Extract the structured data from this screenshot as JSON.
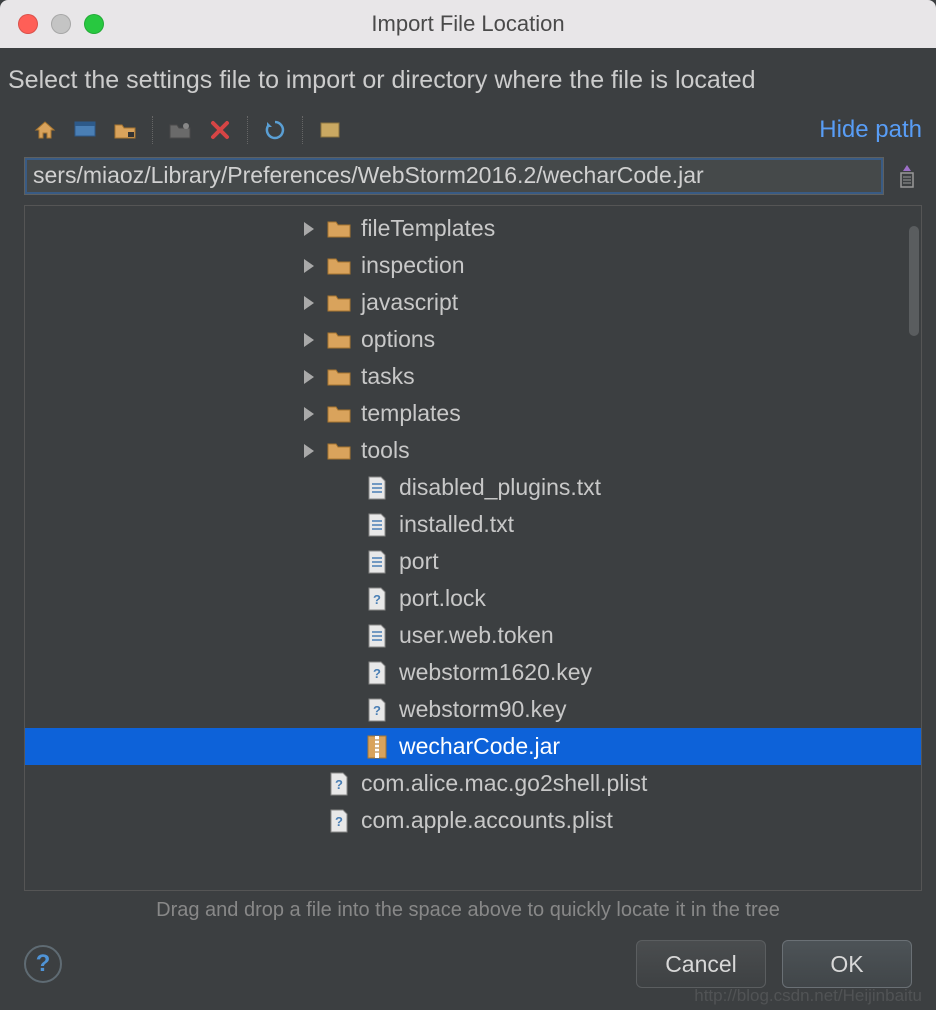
{
  "window": {
    "title": "Import File Location"
  },
  "instruction": "Select the settings file to import or directory where the file is located",
  "toolbar": {
    "hide_path": "Hide path"
  },
  "path_input": "sers/miaoz/Library/Preferences/WebStorm2016.2/wecharCode.jar",
  "tree": [
    {
      "indent": 270,
      "type": "folder",
      "arrow": true,
      "label": "fileTemplates",
      "selected": false
    },
    {
      "indent": 270,
      "type": "folder",
      "arrow": true,
      "label": "inspection",
      "selected": false
    },
    {
      "indent": 270,
      "type": "folder",
      "arrow": true,
      "label": "javascript",
      "selected": false
    },
    {
      "indent": 270,
      "type": "folder",
      "arrow": true,
      "label": "options",
      "selected": false
    },
    {
      "indent": 270,
      "type": "folder",
      "arrow": true,
      "label": "tasks",
      "selected": false
    },
    {
      "indent": 270,
      "type": "folder",
      "arrow": true,
      "label": "templates",
      "selected": false
    },
    {
      "indent": 270,
      "type": "folder",
      "arrow": true,
      "label": "tools",
      "selected": false
    },
    {
      "indent": 308,
      "type": "file",
      "arrow": false,
      "label": "disabled_plugins.txt",
      "selected": false
    },
    {
      "indent": 308,
      "type": "file",
      "arrow": false,
      "label": "installed.txt",
      "selected": false
    },
    {
      "indent": 308,
      "type": "file",
      "arrow": false,
      "label": "port",
      "selected": false
    },
    {
      "indent": 308,
      "type": "unknown",
      "arrow": false,
      "label": "port.lock",
      "selected": false
    },
    {
      "indent": 308,
      "type": "file",
      "arrow": false,
      "label": "user.web.token",
      "selected": false
    },
    {
      "indent": 308,
      "type": "unknown",
      "arrow": false,
      "label": "webstorm1620.key",
      "selected": false
    },
    {
      "indent": 308,
      "type": "unknown",
      "arrow": false,
      "label": "webstorm90.key",
      "selected": false
    },
    {
      "indent": 308,
      "type": "jar",
      "arrow": false,
      "label": "wecharCode.jar",
      "selected": true
    },
    {
      "indent": 270,
      "type": "unknown",
      "arrow": false,
      "label": "com.alice.mac.go2shell.plist",
      "selected": false
    },
    {
      "indent": 270,
      "type": "unknown",
      "arrow": false,
      "label": "com.apple.accounts.plist",
      "selected": false
    }
  ],
  "hint": "Drag and drop a file into the space above to quickly locate it in the tree",
  "buttons": {
    "cancel": "Cancel",
    "ok": "OK"
  },
  "watermark": "http://blog.csdn.net/Heijinbaitu"
}
